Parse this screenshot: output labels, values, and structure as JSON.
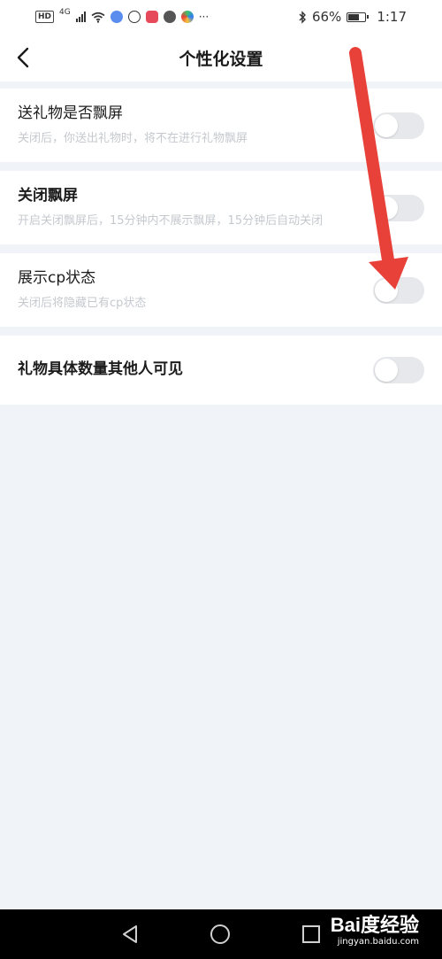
{
  "status_bar": {
    "hd": "HD",
    "network": "4G",
    "battery_percent": "66%",
    "battery_level": 0.66,
    "time": "1:17",
    "more": "···",
    "icons": [
      "hd-icon",
      "signal-icon",
      "wifi-icon",
      "app-icon",
      "bluetooth-icon",
      "battery-icon"
    ]
  },
  "nav": {
    "title": "个性化设置",
    "back_icon": "chevron-left-icon"
  },
  "settings": [
    {
      "title": "送礼物是否飘屏",
      "desc": "关闭后，你送出礼物时，将不在进行礼物飘屏",
      "enabled": false
    },
    {
      "title": "关闭飘屏",
      "desc": "开启关闭飘屏后，15分钟内不展示飘屏，15分钟后自动关闭",
      "enabled": false
    },
    {
      "title": "展示cp状态",
      "desc": "关闭后将隐藏已有cp状态",
      "enabled": false
    },
    {
      "title": "礼物具体数量其他人可见",
      "desc": "",
      "enabled": false
    }
  ],
  "colors": {
    "background": "#f0f3f7",
    "toggle_off": "#e6e8eb",
    "arrow": "#e8413a",
    "desc_text": "#c5c9ce"
  },
  "watermark": {
    "main": "Bai度经验",
    "sub": "jingyan.baidu.com"
  }
}
